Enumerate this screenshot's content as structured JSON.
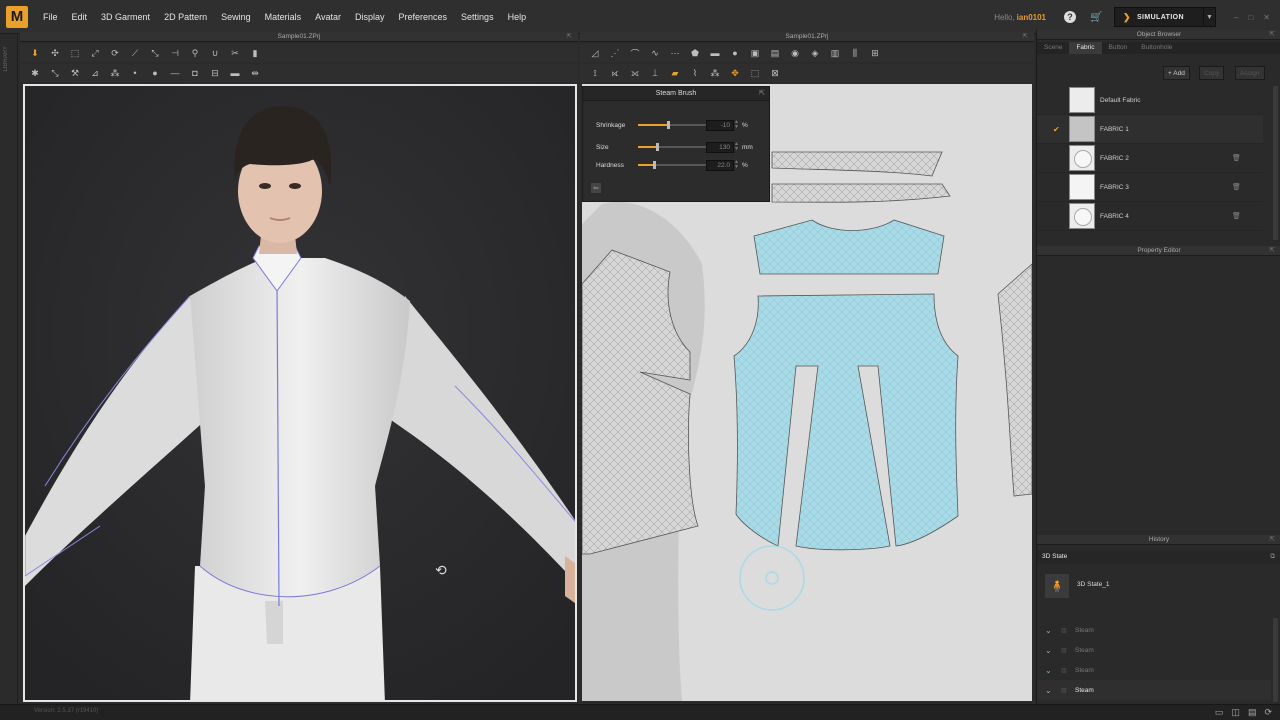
{
  "app": {
    "logo": "M",
    "menu": [
      "File",
      "Edit",
      "3D Garment",
      "2D Pattern",
      "Sewing",
      "Materials",
      "Avatar",
      "Display",
      "Preferences",
      "Settings",
      "Help"
    ],
    "hello_prefix": "Hello,",
    "username": "ian0101",
    "help_icon": "?",
    "mode_label": "SIMULATION",
    "win_controls": [
      "–",
      "□",
      "✕"
    ]
  },
  "left_strip": {
    "label": "LIBRARY"
  },
  "panel_3d": {
    "title": "Sample01.ZPrj",
    "toolbar_row1": [
      "pointer-icon",
      "move-icon",
      "select-icon",
      "transform-icon",
      "lasso-icon",
      "brush-icon",
      "fold-icon",
      "tack-icon",
      "pin-icon",
      "magnet-icon",
      "cut-icon",
      "ruler-icon"
    ],
    "toolbar_row2": [
      "avatar-icon",
      "fit-icon",
      "shirt-icon",
      "measure-icon",
      "arrange-icon",
      "point-icon",
      "circle-icon",
      "line-icon",
      "group-icon",
      "layer-icon",
      "fabric-icon",
      "expand-icon"
    ]
  },
  "panel_2d": {
    "title": "Sample01.ZPrj",
    "steam_brush": {
      "title": "Steam Brush",
      "rows": [
        {
          "label": "Shrinkage",
          "value": "-10",
          "unit": "%",
          "level": 0.42
        },
        {
          "label": "Size",
          "value": "130",
          "unit": "mm",
          "level": 0.26
        },
        {
          "label": "Hardness",
          "value": "22.0",
          "unit": "%",
          "level": 0.22
        }
      ]
    }
  },
  "object_browser": {
    "title": "Object Browser",
    "tabs": [
      "Scene",
      "Fabric",
      "Button",
      "Buttonhole"
    ],
    "active_tab": "Fabric",
    "add_label": "+ Add",
    "copy_label": "Copy",
    "assign_label": "Assign",
    "fabrics": [
      {
        "name": "Default Fabric",
        "selected": false,
        "kind": "plain",
        "trash": false
      },
      {
        "name": "FABRIC 1",
        "selected": true,
        "kind": "plain",
        "trash": false
      },
      {
        "name": "FABRIC 2",
        "selected": false,
        "kind": "button",
        "trash": true
      },
      {
        "name": "FABRIC 3",
        "selected": false,
        "kind": "plain",
        "trash": true
      },
      {
        "name": "FABRIC 4",
        "selected": false,
        "kind": "button",
        "trash": true
      }
    ]
  },
  "property_editor": {
    "title": "Property Editor"
  },
  "history": {
    "title": "History",
    "section": "3D State",
    "state": "3D State_1",
    "items": [
      {
        "name": "Steam",
        "current": false
      },
      {
        "name": "Steam",
        "current": false
      },
      {
        "name": "Steam",
        "current": false
      },
      {
        "name": "Steam",
        "current": true
      }
    ]
  },
  "status": {
    "version": "Version: 2.5.37 (r19410)"
  },
  "colors": {
    "accent": "#e9a12a",
    "pattern_selected": "#a8dbe8",
    "pattern_unselected": "#d6d6d6",
    "shirt": "#e8e8e8",
    "seam_line": "#7a7ad6"
  }
}
